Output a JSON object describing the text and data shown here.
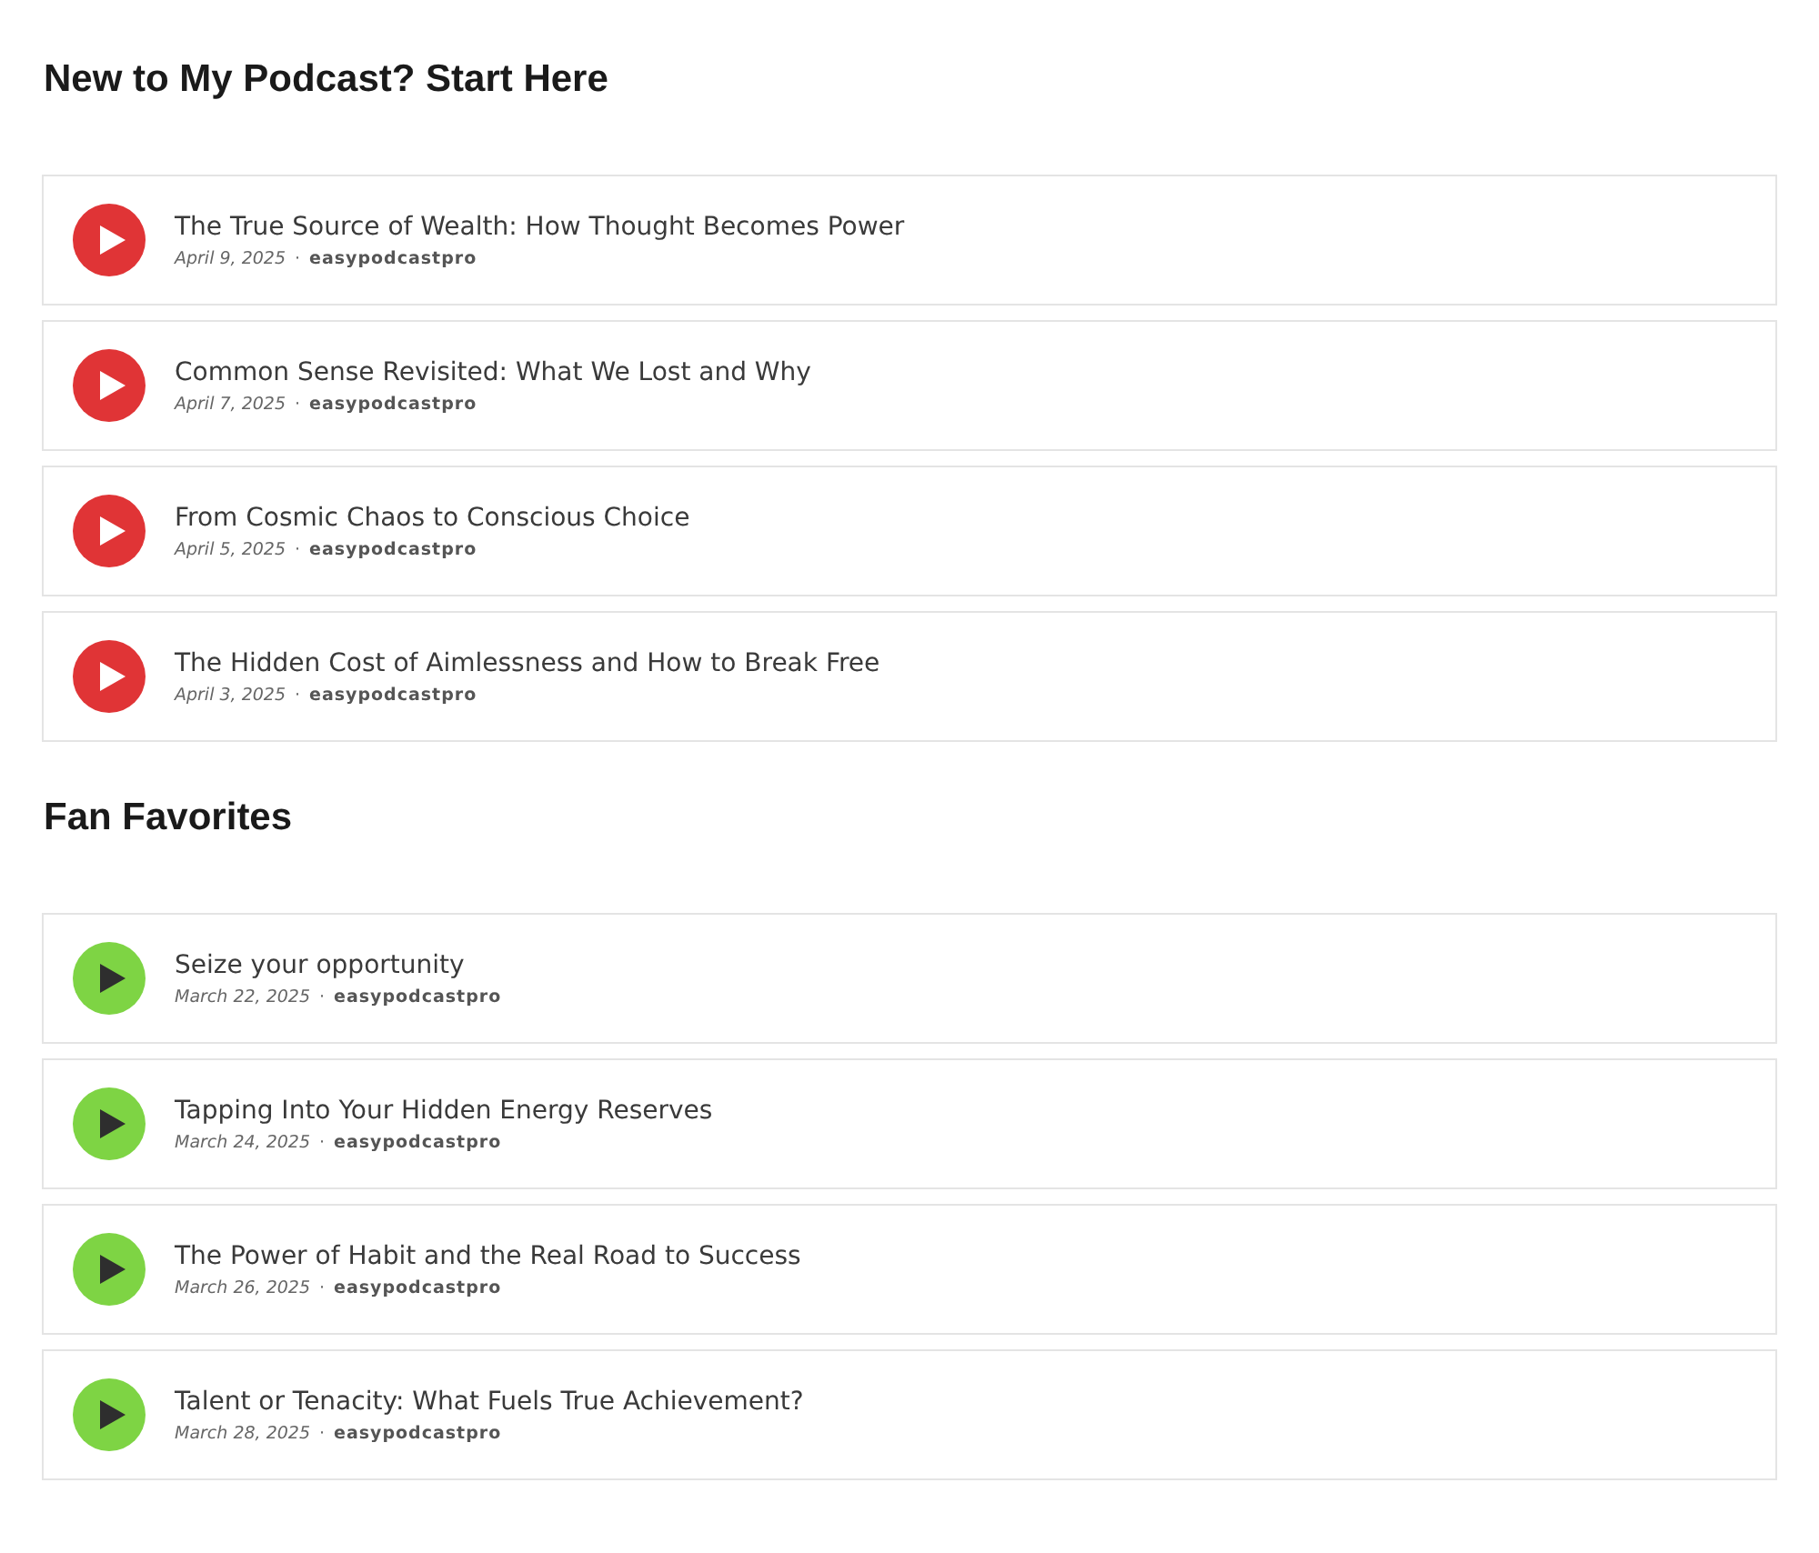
{
  "sections": [
    {
      "heading": "New to My Podcast? Start Here",
      "color": "#e03436",
      "kind": "featured",
      "episodes": [
        {
          "title": "The True Source of Wealth: How Thought Becomes Power",
          "date": "April 9, 2025",
          "separator": "·",
          "author": "easypodcastpro"
        },
        {
          "title": "Common Sense Revisited: What We Lost and Why",
          "date": "April 7, 2025",
          "separator": "·",
          "author": "easypodcastpro"
        },
        {
          "title": "From Cosmic Chaos to Conscious Choice",
          "date": "April 5, 2025",
          "separator": "·",
          "author": "easypodcastpro"
        },
        {
          "title": "The Hidden Cost of Aimlessness and How to Break Free",
          "date": "April 3, 2025",
          "separator": "·",
          "author": "easypodcastpro"
        }
      ]
    },
    {
      "heading": "Fan Favorites",
      "color": "#7ed444",
      "kind": "favorites",
      "episodes": [
        {
          "title": "Seize your opportunity",
          "date": "March 22, 2025",
          "separator": "·",
          "author": "easypodcastpro"
        },
        {
          "title": "Tapping Into Your Hidden Energy Reserves",
          "date": "March 24, 2025",
          "separator": "·",
          "author": "easypodcastpro"
        },
        {
          "title": "The Power of Habit and the Real Road to Success",
          "date": "March 26, 2025",
          "separator": "·",
          "author": "easypodcastpro"
        },
        {
          "title": "Talent or Tenacity: What Fuels True Achievement?",
          "date": "March 28, 2025",
          "separator": "·",
          "author": "easypodcastpro"
        }
      ]
    }
  ]
}
